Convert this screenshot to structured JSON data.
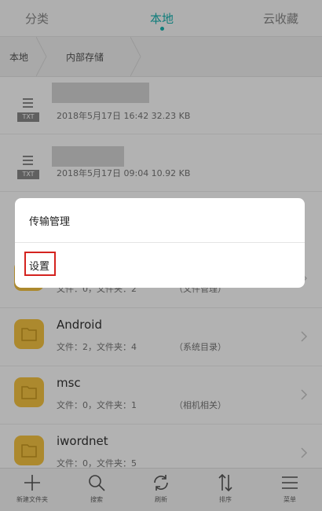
{
  "tabs": [
    {
      "label": "分类",
      "active": false
    },
    {
      "label": "本地",
      "active": true
    },
    {
      "label": "云收藏",
      "active": false
    }
  ],
  "accent_color": "#17b3b0",
  "breadcrumb": [
    "本地",
    "内部存储"
  ],
  "files": [
    {
      "icon": "txt-file-icon",
      "type_label": "TXT",
      "meta": "2018年5月17日  16:42  32.23 KB"
    },
    {
      "icon": "txt-file-icon",
      "type_label": "TXT",
      "meta": "2018年5月17日  09:04  10.92 KB"
    }
  ],
  "folders": [
    {
      "name": "",
      "meta": "文件：0，文件夹：2",
      "tag": "（文件管理）"
    },
    {
      "name": "Android",
      "meta": "文件：2，文件夹：4",
      "tag": "（系统目录）"
    },
    {
      "name": "msc",
      "meta": "文件：0，文件夹：1",
      "tag": "（相机相关）"
    },
    {
      "name": "iwordnet",
      "meta": "文件：0，文件夹：5",
      "tag": ""
    }
  ],
  "popup_menu": {
    "items": [
      "传输管理",
      "设置"
    ],
    "highlighted_item": "设置",
    "highlight_color": "#d4231f"
  },
  "toolbar": [
    {
      "icon": "plus-icon",
      "label": "新建文件夹"
    },
    {
      "icon": "search-icon",
      "label": "搜索"
    },
    {
      "icon": "refresh-icon",
      "label": "刷新"
    },
    {
      "icon": "sort-icon",
      "label": "排序"
    },
    {
      "icon": "menu-icon",
      "label": "菜单"
    }
  ]
}
